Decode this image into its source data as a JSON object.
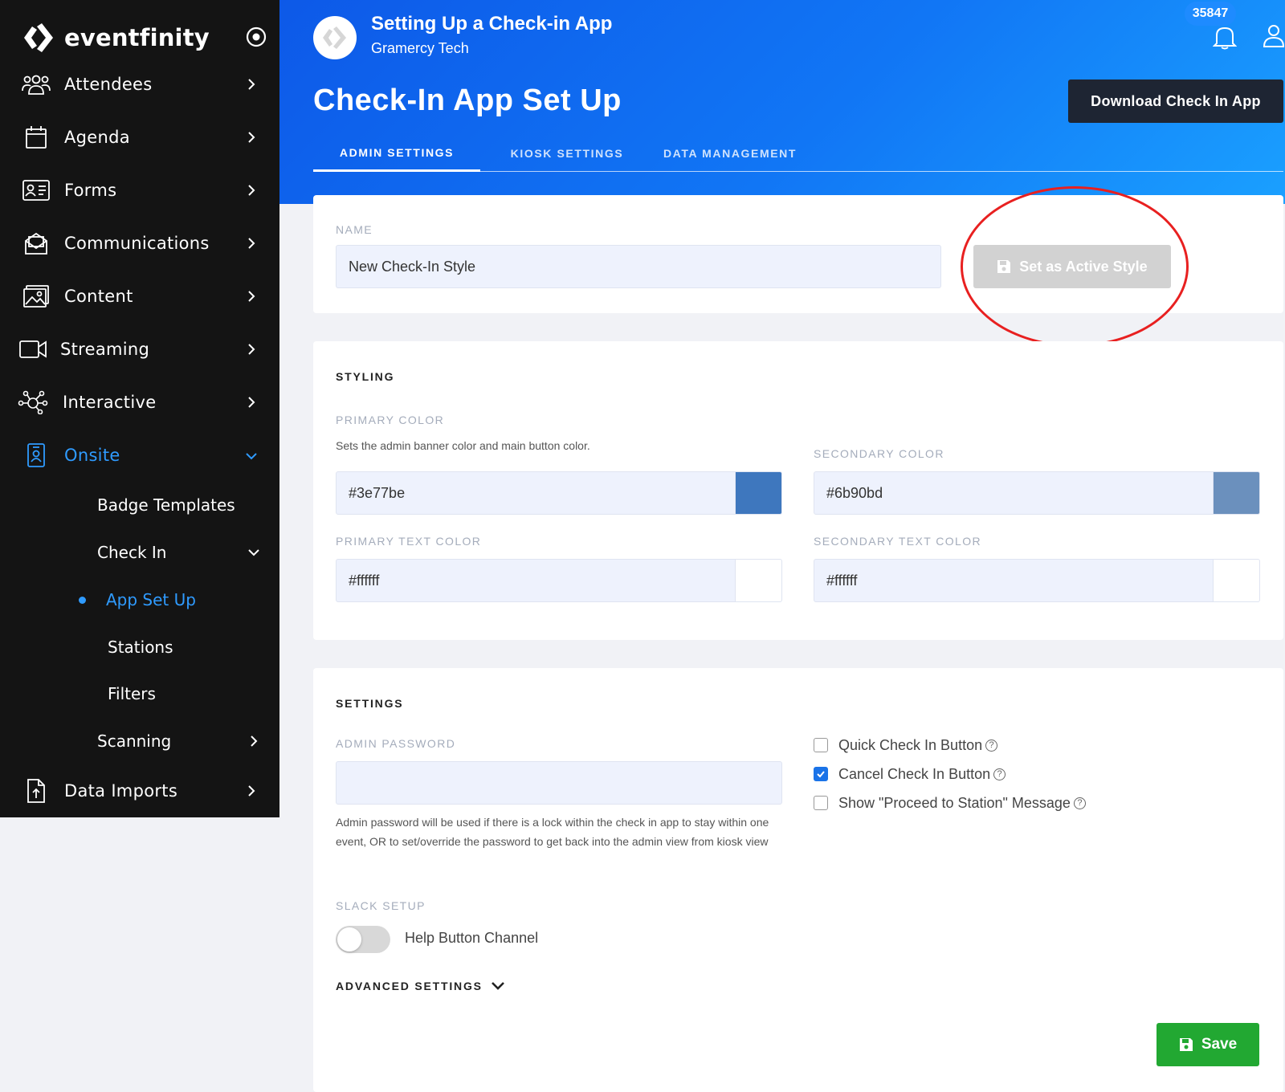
{
  "brand": {
    "name": "eventfinity"
  },
  "sidebar": {
    "items": [
      {
        "label": "Attendees"
      },
      {
        "label": "Agenda"
      },
      {
        "label": "Forms"
      },
      {
        "label": "Communications"
      },
      {
        "label": "Content"
      },
      {
        "label": "Streaming"
      },
      {
        "label": "Interactive"
      },
      {
        "label": "Onsite"
      },
      {
        "label": "Data Imports"
      }
    ],
    "onsite_sub": [
      {
        "label": "Badge Templates"
      },
      {
        "label": "Check In"
      },
      {
        "label": "App Set Up"
      },
      {
        "label": "Stations"
      },
      {
        "label": "Filters"
      },
      {
        "label": "Scanning"
      }
    ]
  },
  "header": {
    "event_title": "Setting Up a Check-in App",
    "event_org": "Gramercy Tech",
    "notification_count": "35847",
    "page_title": "Check-In App Set Up",
    "download_label": "Download Check In App",
    "tabs": [
      {
        "label": "ADMIN SETTINGS"
      },
      {
        "label": "KIOSK SETTINGS"
      },
      {
        "label": "DATA MANAGEMENT"
      }
    ]
  },
  "name_card": {
    "label": "NAME",
    "value": "New Check-In Style",
    "active_style_label": "Set as Active Style"
  },
  "styling": {
    "title": "STYLING",
    "primary_label": "PRIMARY COLOR",
    "primary_help": "Sets the admin banner color and main button color.",
    "primary_value": "#3e77be",
    "secondary_label": "SECONDARY COLOR",
    "secondary_value": "#6b90bd",
    "primary_text_label": "PRIMARY TEXT COLOR",
    "primary_text_value": "#ffffff",
    "secondary_text_label": "SECONDARY TEXT COLOR",
    "secondary_text_value": "#ffffff"
  },
  "settings": {
    "title": "SETTINGS",
    "password_label": "ADMIN PASSWORD",
    "password_value": "",
    "password_help": "Admin password will be used if there is a lock within the check in app to stay within one event, OR to set/override the password to get back into the admin view from kiosk view",
    "checkboxes": [
      {
        "label": "Quick Check In Button",
        "checked": false
      },
      {
        "label": "Cancel Check In Button",
        "checked": true
      },
      {
        "label": "Show \"Proceed to Station\" Message",
        "checked": false
      }
    ],
    "slack_label": "SLACK SETUP",
    "slack_toggle_label": "Help Button Channel",
    "slack_toggle_on": false,
    "advanced_label": "ADVANCED SETTINGS",
    "save_label": "Save"
  },
  "colors": {
    "sidebar_bg": "#141414",
    "active_blue": "#2f9bff",
    "header_gradient_start": "#0d59e8",
    "header_gradient_end": "#1aa0ff",
    "save_green": "#22a832",
    "annotation_red": "#e82020"
  }
}
